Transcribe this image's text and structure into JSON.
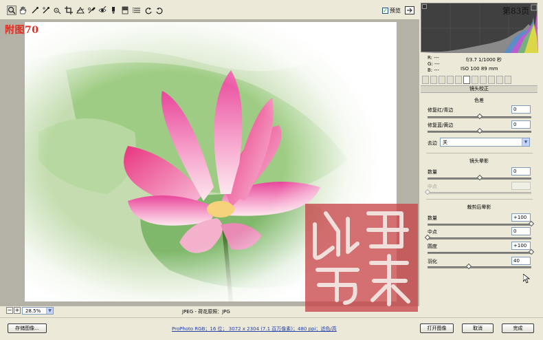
{
  "toolbar": {
    "tools": [
      "zoom-tool",
      "hand-tool",
      "white-balance-tool",
      "color-sampler-tool",
      "targeted-adjustment-tool",
      "crop-tool",
      "straighten-tool",
      "spot-removal-tool",
      "red-eye-tool",
      "adjustment-brush-tool",
      "graduated-filter-tool",
      "preferences",
      "rotate-left",
      "rotate-right"
    ],
    "preview_label": "预览",
    "preview_checked": "✓"
  },
  "overlay": {
    "page_label": "附图70",
    "page_number": "第83页"
  },
  "status": {
    "zoom_value": "28.5%",
    "filename": "JPEG -  荷花原照：JPG"
  },
  "readout": {
    "r": "R:  ---",
    "g": "G:  ---",
    "b": "B:  ---",
    "aperture_shutter": "f/3.7   1/1000 秒",
    "iso_focal": "ISO 100   89 mm"
  },
  "panel": {
    "title": "镜头校正",
    "color": {
      "heading": "色差",
      "fix_red_cyan_label": "修复红/青边",
      "fix_red_cyan_value": "0",
      "fix_blue_yellow_label": "修复蓝/黄边",
      "fix_blue_yellow_value": "0",
      "defringe_label": "去边",
      "defringe_value": "关"
    },
    "vignetting": {
      "heading": "镜头晕影",
      "amount_label": "数量",
      "amount_value": "0",
      "midpoint_label": "中点",
      "midpoint_value": ""
    },
    "post_crop": {
      "heading": "裁剪后晕影",
      "amount_label": "数量",
      "amount_value": "+100",
      "midpoint_label": "中点",
      "midpoint_value": "0",
      "roundness_label": "圆度",
      "roundness_value": "+100",
      "feather_label": "羽化",
      "feather_value": "40"
    },
    "slider_levels": {
      "fix_red_cyan": 0.5,
      "fix_blue_yellow": 0.5,
      "vignette_amount": 0.5,
      "vignette_midpoint": 0.0,
      "postcrop_amount": 1.0,
      "postcrop_midpoint": 0.0,
      "postcrop_roundness": 1.0,
      "postcrop_feather": 0.4
    }
  },
  "footer": {
    "save_label": "存储图像...",
    "workflow_link": "ProPhoto RGB；16 位； 3072 x 2304 (7.1 百万像素)；480 ppi；滤色/高",
    "open_label": "打开图像",
    "cancel_label": "取消",
    "done_label": "完成"
  },
  "colors": {
    "app_bg": "#ece9d8",
    "page_label": "#e8281e",
    "seal": "#c8464a",
    "link": "#1f3ea8"
  }
}
